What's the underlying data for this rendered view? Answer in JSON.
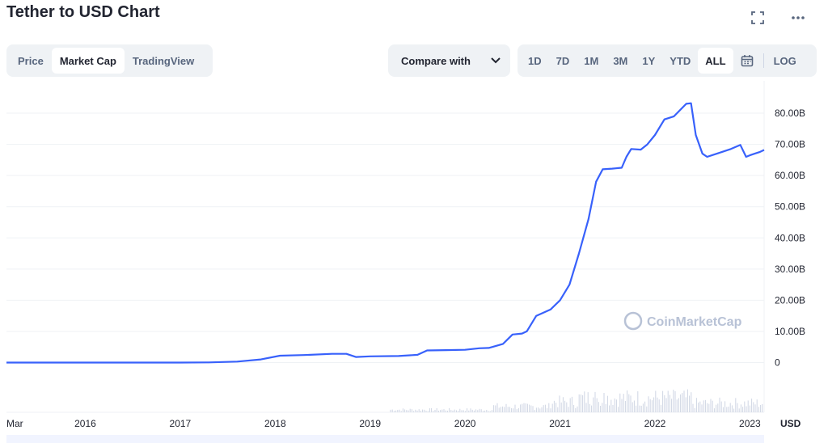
{
  "header": {
    "title": "Tether to USD Chart",
    "fullscreen_icon": "fullscreen-icon",
    "more_icon": "more-icon"
  },
  "view_tabs": [
    {
      "label": "Price",
      "active": false
    },
    {
      "label": "Market Cap",
      "active": true
    },
    {
      "label": "TradingView",
      "active": false
    }
  ],
  "compare": {
    "label": "Compare with",
    "icon": "chevron-down-icon"
  },
  "range_tabs": [
    {
      "label": "1D",
      "active": false
    },
    {
      "label": "7D",
      "active": false
    },
    {
      "label": "1M",
      "active": false
    },
    {
      "label": "3M",
      "active": false
    },
    {
      "label": "1Y",
      "active": false
    },
    {
      "label": "YTD",
      "active": false
    },
    {
      "label": "ALL",
      "active": true
    }
  ],
  "calendar_icon": "calendar-icon",
  "log_label": "LOG",
  "watermark": "CoinMarketCap",
  "colors": {
    "line": "#3861fb",
    "volume": "#cfd6e4",
    "grid": "#eff2f5",
    "text": "#222531",
    "muted": "#58667e"
  },
  "chart_data": {
    "type": "line",
    "title": "Tether to USD Chart",
    "series": [
      {
        "x": [
          2015.17,
          2015.6,
          2016.0,
          2016.5,
          2017.0,
          2017.3,
          2017.6,
          2017.85,
          2018.05,
          2018.3,
          2018.6,
          2018.75,
          2018.85,
          2019.0,
          2019.3,
          2019.5,
          2019.6,
          2019.8,
          2020.0,
          2020.15,
          2020.25,
          2020.4,
          2020.5,
          2020.6,
          2020.65,
          2020.75,
          2020.9,
          2021.0,
          2021.1,
          2021.2,
          2021.3,
          2021.38,
          2021.45,
          2021.55,
          2021.65,
          2021.7,
          2021.75,
          2021.85,
          2021.92,
          2022.0,
          2022.1,
          2022.2,
          2022.33,
          2022.38,
          2022.43,
          2022.5,
          2022.55,
          2022.6,
          2022.7,
          2022.8,
          2022.9,
          2022.96,
          2023.0,
          2023.05,
          2023.1,
          2023.15
        ],
        "y": [
          0,
          0,
          0,
          0,
          0,
          0.05,
          0.3,
          1.0,
          2.2,
          2.4,
          2.8,
          2.8,
          1.8,
          2.0,
          2.1,
          2.5,
          3.9,
          4.0,
          4.1,
          4.6,
          4.7,
          6.0,
          9.0,
          9.3,
          10.0,
          15.0,
          17.0,
          20.0,
          25.0,
          35.0,
          46.0,
          58.0,
          62.0,
          62.2,
          62.5,
          66.0,
          68.5,
          68.3,
          70.0,
          73.0,
          78.0,
          79.0,
          83.0,
          83.2,
          73.0,
          67.0,
          66.0,
          66.5,
          67.5,
          68.5,
          69.8,
          66.0,
          66.5,
          67.0,
          67.5,
          68.2
        ]
      }
    ],
    "x_ticks": [
      "Mar",
      "2016",
      "2017",
      "2018",
      "2019",
      "2020",
      "2021",
      "2022",
      "2023"
    ],
    "y_ticks": [
      "0",
      "10.00B",
      "20.00B",
      "30.00B",
      "40.00B",
      "50.00B",
      "60.00B",
      "70.00B",
      "80.00B"
    ],
    "y_unit": "USD",
    "ylim": [
      0,
      80
    ],
    "grid": true
  }
}
